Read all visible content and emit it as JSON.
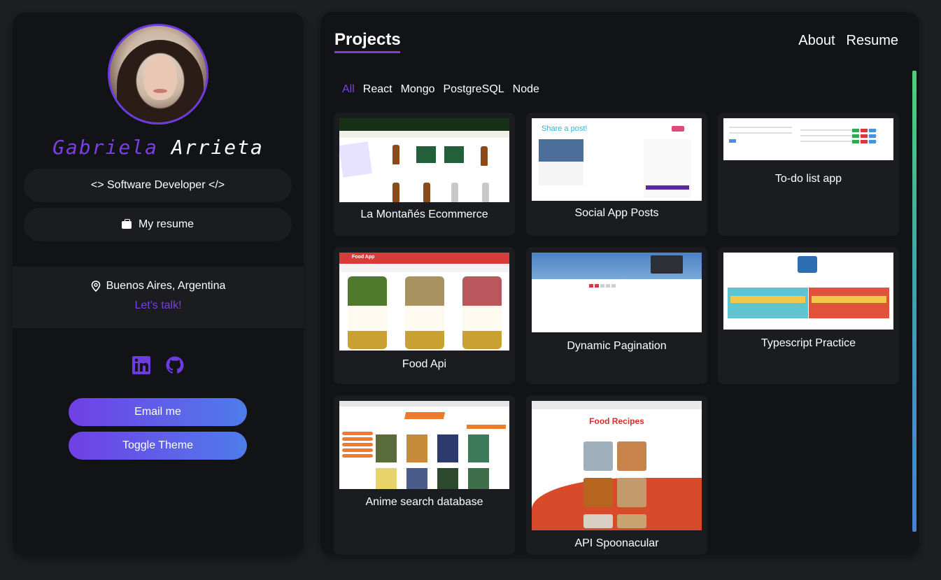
{
  "profile": {
    "first_name": "Gabriela",
    "last_name": "Arrieta",
    "role": "<> Software Developer </>",
    "resume_label": "My resume",
    "location": "Buenos Aires, Argentina",
    "talk_label": "Let's talk!",
    "email_button": "Email me",
    "theme_button": "Toggle Theme",
    "social_icons": [
      "linkedin-icon",
      "github-icon"
    ]
  },
  "header": {
    "title": "Projects",
    "nav": [
      "About",
      "Resume"
    ]
  },
  "filters": {
    "items": [
      "All",
      "React",
      "Mongo",
      "PostgreSQL",
      "Node"
    ],
    "active": "All"
  },
  "projects": [
    {
      "name": "La Montañés Ecommerce"
    },
    {
      "name": "Social App Posts"
    },
    {
      "name": "To-do list app"
    },
    {
      "name": "Food Api"
    },
    {
      "name": "Dynamic Pagination"
    },
    {
      "name": "Typescript Practice"
    },
    {
      "name": "Anime search database"
    },
    {
      "name": "API Spoonacular"
    }
  ],
  "thumb_text": {
    "social_banner": "Share a post!",
    "food_logo": "Food App",
    "spoon_title": "Food Recipes"
  },
  "colors": {
    "accent": "#7b3fe4",
    "panel": "#121316",
    "card": "#1b1c20",
    "background": "#1e1f23",
    "button_gradient_start": "#7040e6",
    "button_gradient_end": "#4f7cea"
  }
}
